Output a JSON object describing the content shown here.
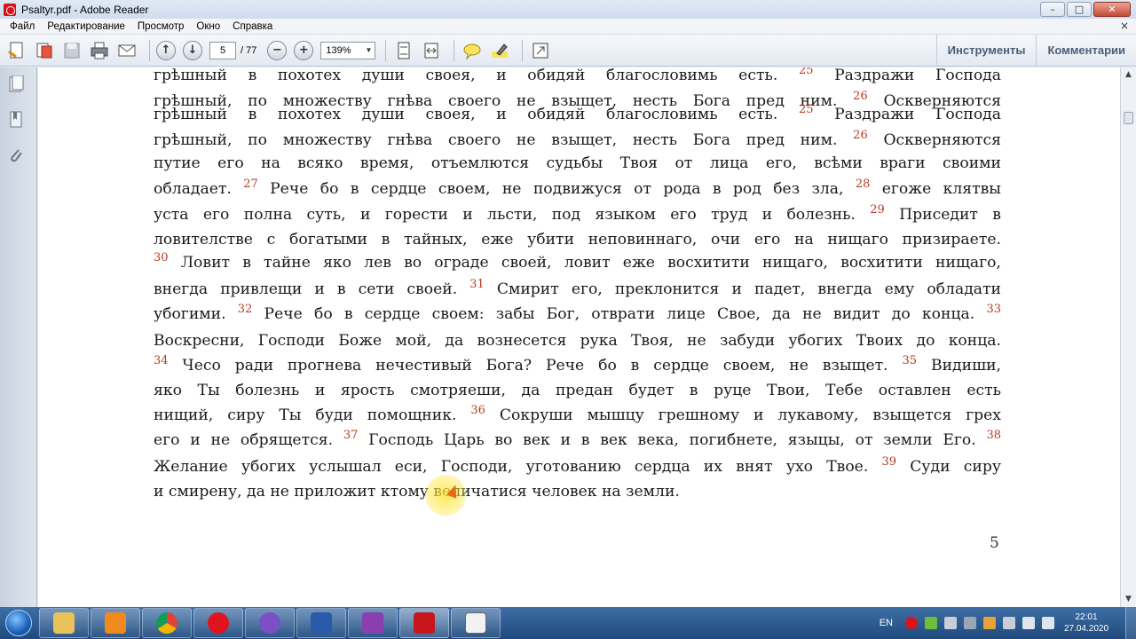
{
  "window": {
    "title": "Psaltyr.pdf - Adobe Reader",
    "minimize": "–",
    "maximize": "□",
    "close": "✕"
  },
  "menu": {
    "items": [
      "Файл",
      "Редактирование",
      "Просмотр",
      "Окно",
      "Справка"
    ],
    "close": "×"
  },
  "toolbar": {
    "current_page": "5",
    "total_pages": "/ 77",
    "zoom": "139%",
    "tools_label": "Инструменты",
    "comments_label": "Комментарии"
  },
  "document": {
    "lines": [
      {
        "text": "грѣшный в похотех души своея, и обидяй благословимь есть.",
        "num": "25",
        "after": " Раздражи Господа"
      },
      {
        "text": "грѣшный, по множеству гнѣва своего не взыщет, несть Бога пред ним.",
        "num": "26",
        "after": " Оскверняются"
      },
      {
        "text": "грѣшный в похотех души своея, и обидяй благословимь есть.",
        "num": "25",
        "after": " Раздражи Господа"
      },
      {
        "text": "грѣшный, по множеству гнѣва своего не взыщет, несть Бога пред ним.",
        "num": "26",
        "after": " Оскверняются"
      },
      {
        "text": "путие его на всяко время, отъемлются судьбы Твоя от лица его, всѣми враги своими",
        "num": "",
        "after": ""
      },
      {
        "text": "обладает.",
        "num": "27",
        "after": " Рече бо в сердце своем, не подвижуся от рода в род без зла,",
        "num2": "28",
        "after2": " егоже клятвы"
      },
      {
        "text": "уста его полна суть, и горести и льсти, под языком его труд и болезнь.",
        "num": "29",
        "after": " Приседит в"
      },
      {
        "text": "ловителстве с богатыми в тайных,  еже убити неповиннаго, очи его на нищаго призираете.",
        "num": "",
        "after": ""
      },
      {
        "pre_num": "30",
        "text": " Ловит в тайне яко лев во ограде своей, ловит еже восхитити нищаго, восхитити нищаго,",
        "num": "",
        "after": ""
      },
      {
        "text": "внегда привлещи и в сети своей.",
        "num": "31",
        "after": " Смирит его, преклонится и падет, внегда ему обладати"
      },
      {
        "text": "убогими.",
        "num": "32",
        "after": " Рече бо в сердце своем: забы Бог, отврати лице Свое, да не видит до конца.",
        "num2": "33",
        "after2": ""
      },
      {
        "text": "Воскресни, Господи Боже мой, да вознесется рука Твоя, не забуди убогих Твоих до конца.",
        "num": "",
        "after": ""
      },
      {
        "pre_num": "34",
        "text": " Чесо ради прогнева нечестивый Бога? Рече бо в сердце своем, не взыщет.",
        "num": "35",
        "after": " Видиши,"
      },
      {
        "text": "яко Ты болезнь и ярость смотряеши, да предан будет в руце Твои, Тебе оставлен есть",
        "num": "",
        "after": ""
      },
      {
        "text": "нищий, сиру Ты буди помощник.",
        "num": "36",
        "after": " Сокруши мышцу грешному и лукавому, взыщется грех"
      },
      {
        "text": "его и не обрящется.",
        "num": "37",
        "after": " Господь Царь во век и в век века, погибнете, языцы, от земли Его.",
        "num2": "38",
        "after2": ""
      },
      {
        "text": "Желание убогих услышал еси, Господи, уготованию сердца их внят ухо Твое.",
        "num": "39",
        "after": " Суди сиру"
      },
      {
        "text": "и смирену, да не приложит ктому величатися человек на земли.",
        "num": "",
        "after": ""
      }
    ],
    "page_number": "5"
  },
  "taskbar": {
    "apps": [
      "windows-explorer",
      "media-player",
      "chrome",
      "opera",
      "viber",
      "word",
      "presentation",
      "adobe-reader",
      "notepad"
    ],
    "language": "EN",
    "time": "22:01",
    "date": "27.04.2020"
  },
  "colors": {
    "verse_number": "#b83a1f",
    "taskbar": "#2a5a91",
    "cursor_highlight": "#ffe63c"
  }
}
